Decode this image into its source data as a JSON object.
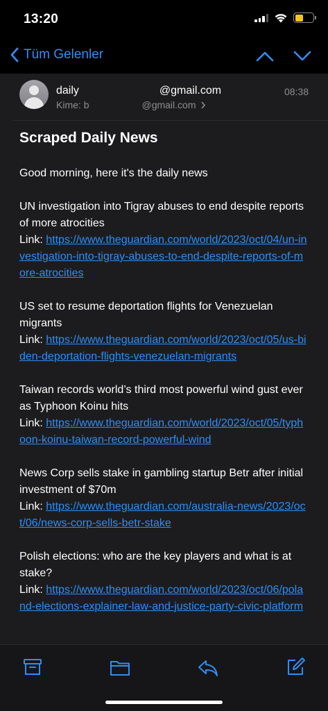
{
  "status": {
    "time": "13:20"
  },
  "nav": {
    "back_label": "Tüm Gelenler"
  },
  "header": {
    "from_prefix": "daily",
    "from_suffix": "@gmail.com",
    "to_label": "Kime:",
    "to_prefix": "b",
    "to_suffix": "@gmail.com",
    "time": "08:38"
  },
  "mail": {
    "subject": "Scraped Daily News",
    "greeting": "Good morning, here it's the daily news",
    "link_label": "Link:",
    "items": [
      {
        "title": "UN investigation into Tigray abuses to end despite reports of more atrocities",
        "url": "https://www.theguardian.com/world/2023/oct/04/un-investigation-into-tigray-abuses-to-end-despite-reports-of-more-atrocities"
      },
      {
        "title": "US set to resume deportation flights for Venezuelan migrants",
        "url": "https://www.theguardian.com/world/2023/oct/05/us-biden-deportation-flights-venezuelan-migrants"
      },
      {
        "title": "Taiwan records world’s third most powerful wind gust ever as Typhoon Koinu hits",
        "url": "https://www.theguardian.com/world/2023/oct/05/typhoon-koinu-taiwan-record-powerful-wind"
      },
      {
        "title": "News Corp sells stake in gambling startup Betr after initial investment of $70m",
        "url": "https://www.theguardian.com/australia-news/2023/oct/06/news-corp-sells-betr-stake"
      },
      {
        "title": "Polish elections: who are the key players and what is at stake?",
        "url": "https://www.theguardian.com/world/2023/oct/06/poland-elections-explainer-law-and-justice-party-civic-platform"
      }
    ]
  },
  "toolbar": {
    "icons": [
      "archive-icon",
      "folder-icon",
      "reply-icon",
      "compose-icon"
    ]
  },
  "colors": {
    "accent": "#2f8ef7",
    "background": "#1c1c1e",
    "battery": "#f5c518"
  }
}
